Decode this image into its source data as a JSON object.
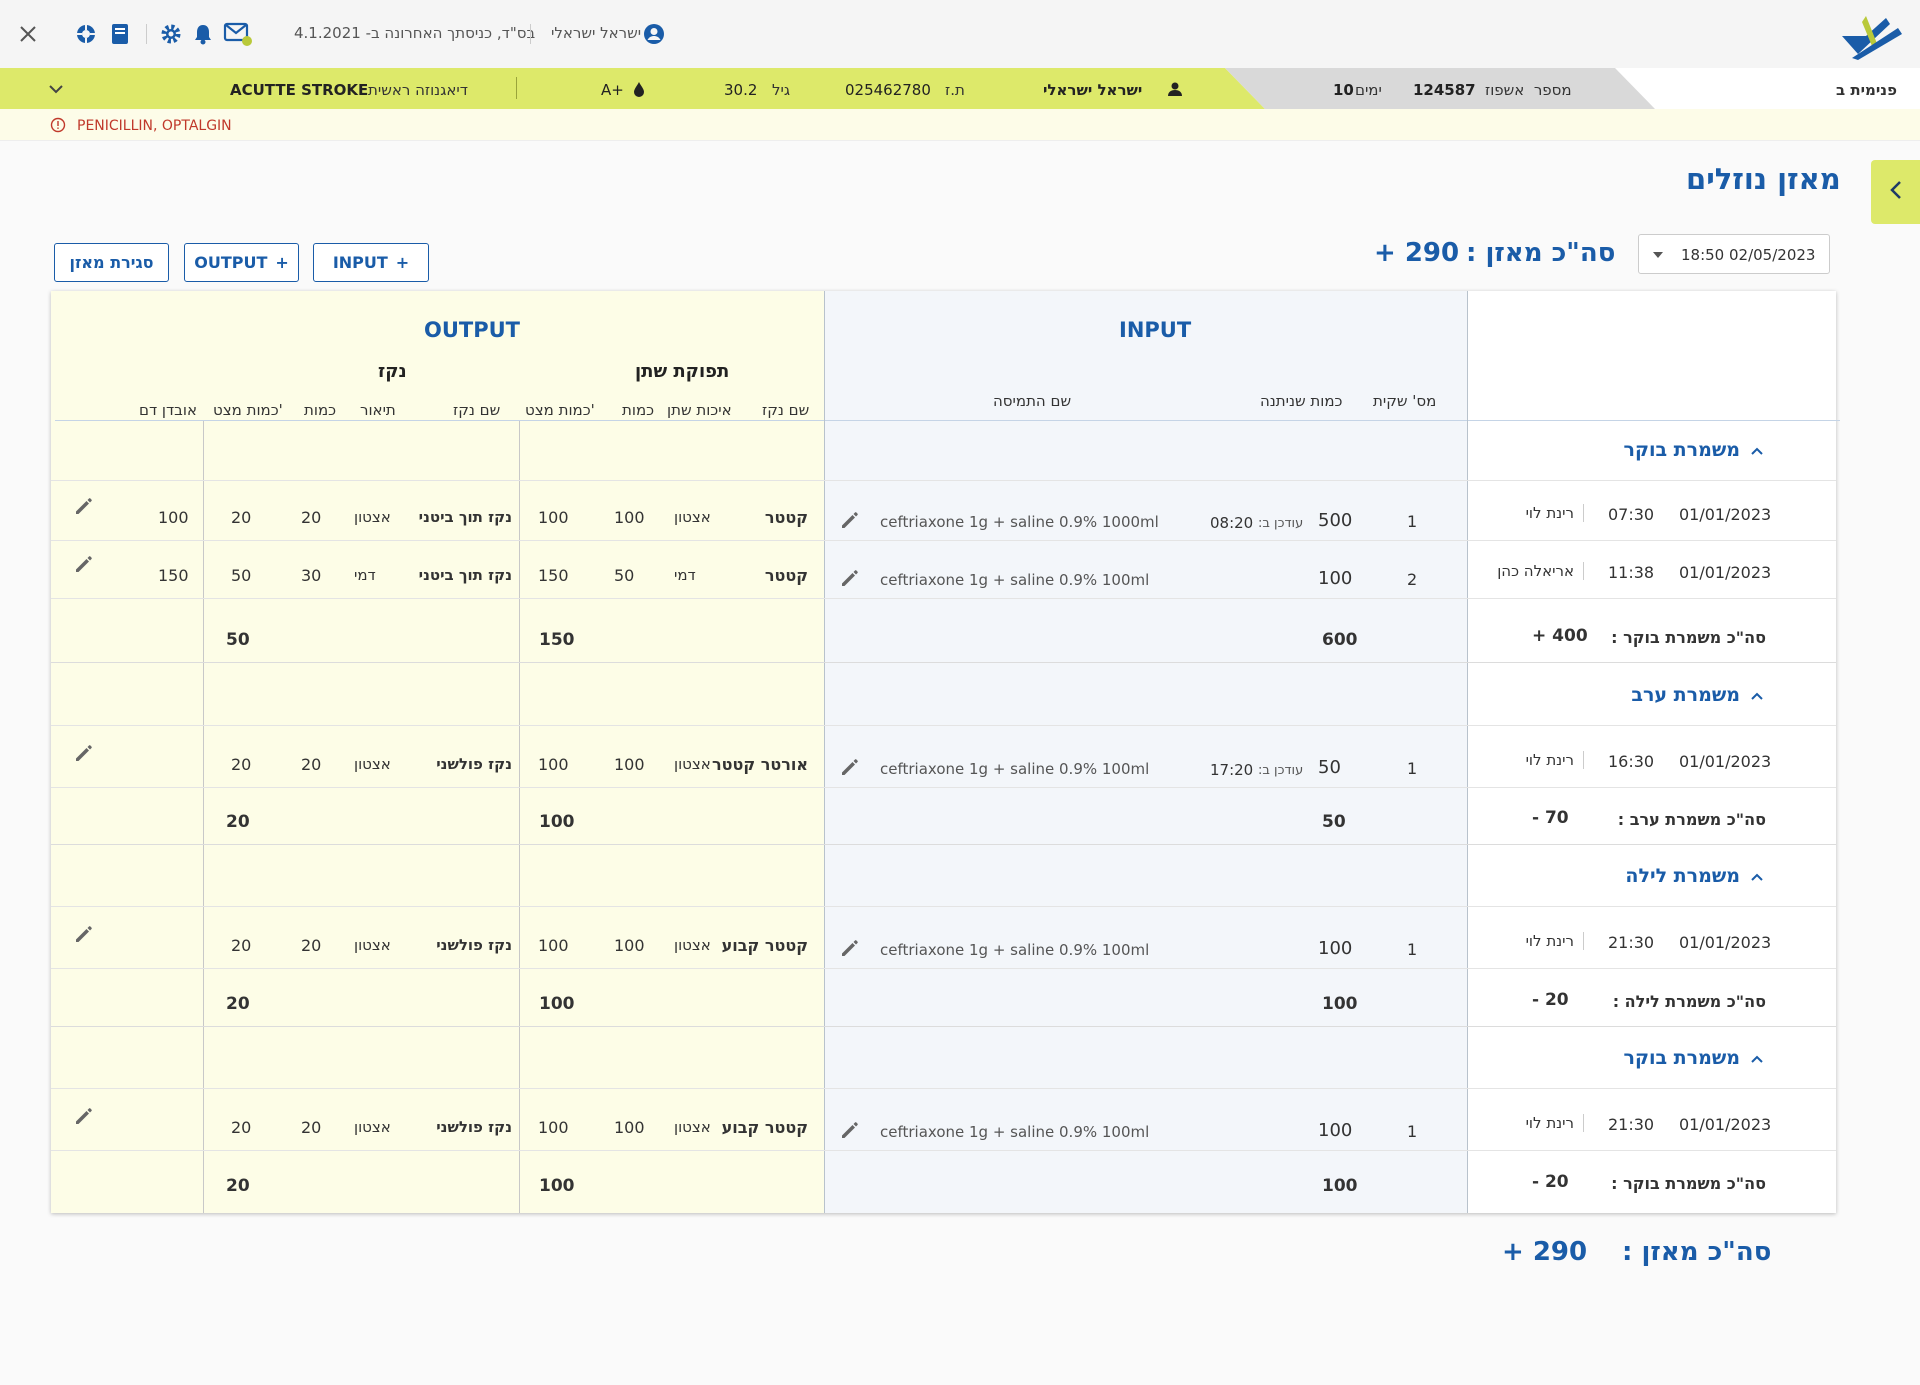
{
  "topbar": {
    "user_name": "ישראל ישראלי",
    "last_login": "בס\"ד, כניסתך האחרונה ב- 4.1.2021",
    "department": "פנימית ב"
  },
  "patient": {
    "name": "ישראל ישראלי",
    "id_label": "ת.ז",
    "id_value": "025462780",
    "age_label": "גיל",
    "age_value": "30.2",
    "blood_type": "A+",
    "diagnosis_label": "דיאגנוזה ראשית",
    "diagnosis_value": "ACUTTE STROKE",
    "admission_label": "מספר  אשפוז",
    "admission_number": "124587",
    "days_label": "ימים",
    "days_value": "10",
    "allergies": "PENICILLIN, OPTALGIN"
  },
  "page": {
    "title": "מאזן נוזלים",
    "date_value": "18:50 02/05/2023",
    "total_label": "סה\"כ מאזן :",
    "total_value": "+ 290",
    "btn_input": "INPUT",
    "btn_output": "OUTPUT",
    "btn_close": "סגירת מאזן"
  },
  "headers": {
    "input": "INPUT",
    "output": "OUTPUT",
    "urine_group": "תפוקת שתן",
    "stool_group": "נקז",
    "bag_no": "מס' שקית",
    "amount_given": "כמות שניתנה",
    "solution_name": "שם התמיסה",
    "drain_name": "שם נקז",
    "urine_quality": "איכות שתן",
    "amount": "כמות",
    "cum_amount": "כמות מצט'",
    "drain_name2": "שם נקז",
    "description": "תיאור",
    "amount2": "כמות",
    "cum_amount2": "כמות מצט'",
    "blood_loss": "אובדן דם"
  },
  "updated_label": "עודכן ב:",
  "shifts": [
    {
      "name": "משמרת בוקר",
      "total_label": "סה\"כ משמרת בוקר :",
      "balance": "+ 400",
      "input_total": "600",
      "urine_total": "150",
      "drain_total": "50",
      "rows": [
        {
          "date": "01/01/2023",
          "time": "07:30",
          "nurse": "רינת לוי",
          "bag": "1",
          "amount": "500",
          "updated": "08:20",
          "solution": "ceftriaxone 1g + saline 0.9% 1000ml",
          "u_name": "קטטר",
          "u_quality": "אצטון",
          "u_amount": "100",
          "u_cum": "100",
          "d_name": "נקז תוך ביטני",
          "d_desc": "אצטון",
          "d_amount": "20",
          "d_cum": "20",
          "blood": "100"
        },
        {
          "date": "01/01/2023",
          "time": "11:38",
          "nurse": "אריאלה כהן",
          "bag": "2",
          "amount": "100",
          "updated": "",
          "solution": "ceftriaxone 1g + saline 0.9% 100ml",
          "u_name": "קטטר",
          "u_quality": "דמי",
          "u_amount": "50",
          "u_cum": "150",
          "d_name": "נקז תוך ביטני",
          "d_desc": "דמי",
          "d_amount": "30",
          "d_cum": "50",
          "blood": "150"
        }
      ]
    },
    {
      "name": "משמרת ערב",
      "total_label": "סה\"כ משמרת ערב :",
      "balance": "- 70",
      "input_total": "50",
      "urine_total": "100",
      "drain_total": "20",
      "rows": [
        {
          "date": "01/01/2023",
          "time": "16:30",
          "nurse": "רינת לוי",
          "bag": "1",
          "amount": "50",
          "updated": "17:20",
          "solution": "ceftriaxone 1g + saline 0.9% 100ml",
          "u_name": "אורטר קטטר",
          "u_quality": "אצטון",
          "u_amount": "100",
          "u_cum": "100",
          "d_name": "נקז פולשני",
          "d_desc": "אצטון",
          "d_amount": "20",
          "d_cum": "20",
          "blood": ""
        }
      ]
    },
    {
      "name": "משמרת לילה",
      "total_label": "סה\"כ משמרת לילה :",
      "balance": "- 20",
      "input_total": "100",
      "urine_total": "100",
      "drain_total": "20",
      "rows": [
        {
          "date": "01/01/2023",
          "time": "21:30",
          "nurse": "רינת לוי",
          "bag": "1",
          "amount": "100",
          "updated": "",
          "solution": "ceftriaxone 1g + saline 0.9% 100ml",
          "u_name": "קטטר קבוע",
          "u_quality": "אצטון",
          "u_amount": "100",
          "u_cum": "100",
          "d_name": "נקז פולשני",
          "d_desc": "אצטון",
          "d_amount": "20",
          "d_cum": "20",
          "blood": ""
        }
      ]
    },
    {
      "name": "משמרת בוקר",
      "total_label": "סה\"כ משמרת בוקר :",
      "balance": "- 20",
      "input_total": "100",
      "urine_total": "100",
      "drain_total": "20",
      "rows": [
        {
          "date": "01/01/2023",
          "time": "21:30",
          "nurse": "רינת לוי",
          "bag": "1",
          "amount": "100",
          "updated": "",
          "solution": "ceftriaxone 1g + saline 0.9% 100ml",
          "u_name": "קטטר קבוע",
          "u_quality": "אצטון",
          "u_amount": "100",
          "u_cum": "100",
          "d_name": "נקז פולשני",
          "d_desc": "אצטון",
          "d_amount": "20",
          "d_cum": "20",
          "blood": ""
        }
      ]
    }
  ],
  "footer": {
    "total_label": "סה\"כ מאזן :",
    "total_value": "+ 290"
  }
}
